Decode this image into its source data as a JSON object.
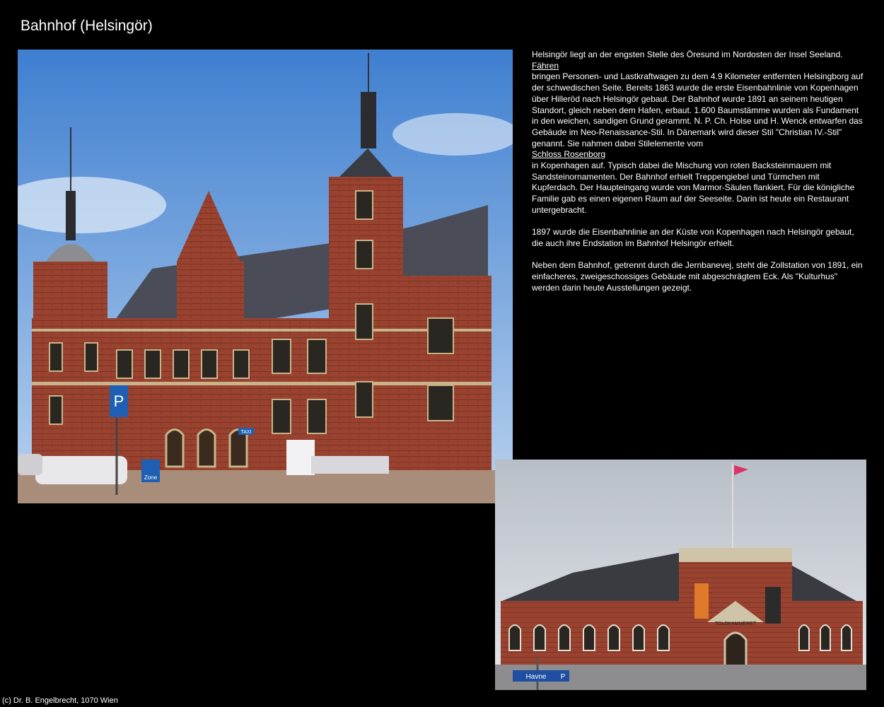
{
  "page": {
    "title": "Bahnhof (Helsingör)",
    "footer": "(c) Dr. B. Engelbrecht, 1070 Wien"
  },
  "description": {
    "p1_before_link1": "Helsingör liegt an der engsten Stelle des Öresund im Nordosten der Insel Seeland.",
    "link1": "Fähren",
    "p1_after_link1": "bringen Personen- und Lastkraftwagen zu dem 4.9 Kilometer entfernten Helsingborg auf der schwedischen Seite. Bereits 1863 wurde die erste Eisenbahnlinie von Kopenhagen über Hilleröd nach Helsingör gebaut. Der Bahnhof wurde 1891 an seinem heutigen Standort, gleich neben dem Hafen, erbaut. 1.600 Baumstämme wurden als Fundament in den weichen, sandigen Grund gerammt. N. P. Ch. Holse und H. Wenck entwarfen das Gebäude im Neo-Renaissance-Stil. In Dänemark wird dieser Stil \"Christian IV.-Stil\" genannt. Sie nahmen dabei Stilelemente vom",
    "link2": "Schloss Rosenborg",
    "p1_after_link2": "in Kopenhagen auf. Typisch dabei die Mischung von roten Backsteinmauern mit Sandsteinornamenten. Der Bahnhof erhielt Treppengiebel und Türmchen mit Kupferdach. Der Haupteingang wurde von Marmor-Säulen flankiert. Für die königliche Familie gab es einen eigenen Raum auf der Seeseite. Darin ist heute ein Restaurant untergebracht.",
    "p2": "1897 wurde die Eisenbahnlinie an der Küste von Kopenhagen nach Helsingör gebaut, die auch ihre Endstation im Bahnhof Helsingör erhielt.",
    "p3": "Neben dem Bahnhof, getrennt durch die Jernbanevej, steht die Zollstation von 1891, ein einfacheres, zweigeschossiges Gebäude mit abgeschrägtem Eck. Als \"Kulturhus\" werden darin heute Ausstellungen gezeigt."
  },
  "photos": {
    "station_signs": {
      "parking": "P",
      "taxi": "TAXI",
      "zone": "Zone"
    },
    "customs_house": {
      "facade_sign": "TOLDKAMMERET",
      "street_sign": "Havne",
      "street_sign_p": "P"
    }
  },
  "colors": {
    "sky": "#8fb6e6",
    "brick": "#9a4230",
    "roof": "#4a4d57",
    "sandstone": "#c9b48a"
  }
}
